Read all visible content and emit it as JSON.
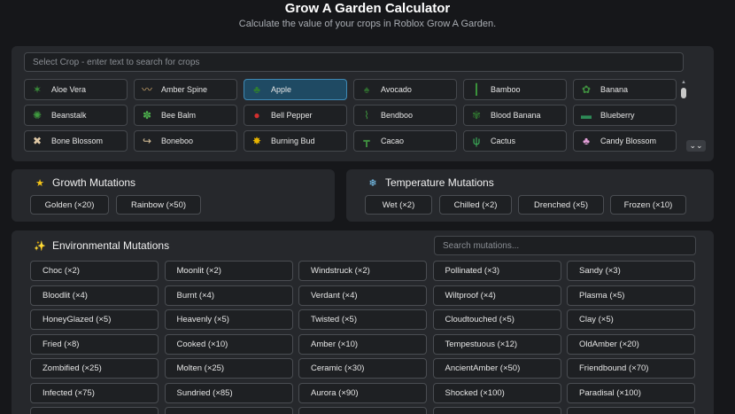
{
  "header": {
    "title": "Grow A Garden Calculator",
    "subtitle": "Calculate the value of your crops in Roblox Grow A Garden."
  },
  "crop_selector": {
    "search_placeholder": "Select Crop - enter text to search for crops",
    "selected": "Apple",
    "crops": [
      {
        "label": "Aloe Vera",
        "icon": "aloe-vera-icon",
        "glyph": "✶",
        "color": "#3a8f3a"
      },
      {
        "label": "Amber Spine",
        "icon": "amber-spine-icon",
        "glyph": "〰",
        "color": "#c9a36a"
      },
      {
        "label": "Apple",
        "icon": "apple-tree-icon",
        "glyph": "♣",
        "color": "#2e7d32"
      },
      {
        "label": "Avocado",
        "icon": "avocado-icon",
        "glyph": "♠",
        "color": "#2f6b2f"
      },
      {
        "label": "Bamboo",
        "icon": "bamboo-icon",
        "glyph": "┃",
        "color": "#3c9a3c"
      },
      {
        "label": "Banana",
        "icon": "banana-icon",
        "glyph": "✿",
        "color": "#3f8f3f"
      },
      {
        "label": "Beanstalk",
        "icon": "beanstalk-icon",
        "glyph": "✺",
        "color": "#3f9a3f"
      },
      {
        "label": "Bee Balm",
        "icon": "bee-balm-icon",
        "glyph": "✽",
        "color": "#4cae4c"
      },
      {
        "label": "Bell Pepper",
        "icon": "bell-pepper-icon",
        "glyph": "●",
        "color": "#d32f2f"
      },
      {
        "label": "Bendboo",
        "icon": "bendboo-icon",
        "glyph": "⌇",
        "color": "#3c8f3c"
      },
      {
        "label": "Blood Banana",
        "icon": "blood-banana-icon",
        "glyph": "✾",
        "color": "#2f6f2f"
      },
      {
        "label": "Blueberry",
        "icon": "blueberry-icon",
        "glyph": "▬",
        "color": "#2e8b57"
      },
      {
        "label": "Bone Blossom",
        "icon": "bone-blossom-icon",
        "glyph": "✖",
        "color": "#e0c9a6"
      },
      {
        "label": "Boneboo",
        "icon": "boneboo-icon",
        "glyph": "↪",
        "color": "#d9c29a"
      },
      {
        "label": "Burning Bud",
        "icon": "burning-bud-icon",
        "glyph": "✸",
        "color": "#e8b400"
      },
      {
        "label": "Cacao",
        "icon": "cacao-icon",
        "glyph": "┳",
        "color": "#3f8f3f"
      },
      {
        "label": "Cactus",
        "icon": "cactus-icon",
        "glyph": "ψ",
        "color": "#3fbf5f"
      },
      {
        "label": "Candy Blossom",
        "icon": "candy-blossom-icon",
        "glyph": "♣",
        "color": "#e39fd8"
      }
    ]
  },
  "growth_mutations": {
    "title": "Growth Mutations",
    "icon": "star-icon",
    "items": [
      "Golden (×20)",
      "Rainbow (×50)"
    ]
  },
  "temperature_mutations": {
    "title": "Temperature Mutations",
    "icon": "snowflake-icon",
    "items": [
      "Wet (×2)",
      "Chilled (×2)",
      "Drenched (×5)",
      "Frozen (×10)"
    ]
  },
  "environmental_mutations": {
    "title": "Environmental Mutations",
    "icon": "sparkles-icon",
    "search_placeholder": "Search mutations...",
    "items": [
      "Choc (×2)",
      "Moonlit (×2)",
      "Windstruck (×2)",
      "Pollinated (×3)",
      "Sandy (×3)",
      "Bloodlit (×4)",
      "Burnt (×4)",
      "Verdant (×4)",
      "Wiltproof (×4)",
      "Plasma (×5)",
      "HoneyGlazed (×5)",
      "Heavenly (×5)",
      "Twisted (×5)",
      "Cloudtouched (×5)",
      "Clay (×5)",
      "Fried (×8)",
      "Cooked (×10)",
      "Amber (×10)",
      "Tempestuous (×12)",
      "OldAmber (×20)",
      "Zombified (×25)",
      "Molten (×25)",
      "Ceramic (×30)",
      "AncientAmber (×50)",
      "Friendbound (×70)",
      "Infected (×75)",
      "Sundried (×85)",
      "Aurora (×90)",
      "Shocked (×100)",
      "Paradisal (×100)",
      "",
      "",
      "",
      "",
      ""
    ]
  }
}
